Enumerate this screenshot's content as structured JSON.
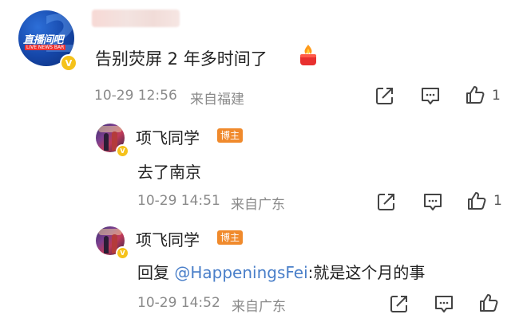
{
  "main_comment": {
    "avatar_brand": "直播间吧",
    "avatar_sub": "LIVE NEWS BAR",
    "text": "告别荧屏 2 年多时间了",
    "emoji": "fire-candle-emoji",
    "date": "10-29 12:56",
    "location": "来自福建",
    "like_count": "1"
  },
  "replies": [
    {
      "name": "项飞同学",
      "badge": "博主",
      "text": "去了南京",
      "date": "10-29 14:51",
      "location": "来自广东",
      "like_count": "1"
    },
    {
      "name": "项飞同学",
      "badge": "博主",
      "prefix": "回复 ",
      "mention": "@HappeningsFei",
      "text": ":就是这个月的事",
      "date": "10-29 14:52",
      "location": "来自广东",
      "like_count": ""
    }
  ],
  "colors": {
    "verified_badge": "#f5c21b",
    "blogger_badge": "#f08a2c",
    "mention": "#4a7fc9",
    "meta": "#8a8a8a"
  },
  "icons": [
    "share-icon",
    "comment-icon",
    "like-icon",
    "verified-icon"
  ]
}
